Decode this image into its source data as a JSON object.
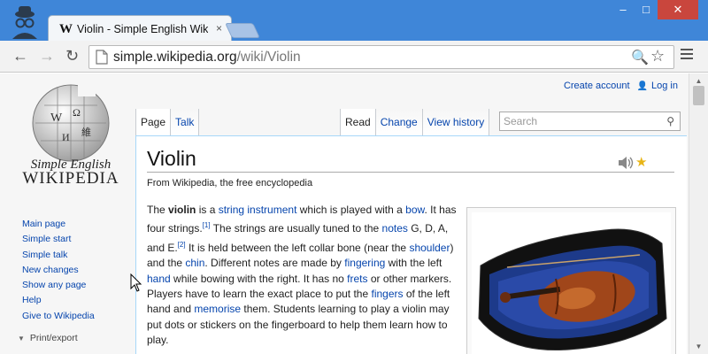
{
  "browser": {
    "tab_favicon": "W",
    "tab_title": "Violin - Simple English Wiki",
    "tab_close": "×",
    "url_host": "simple.wikipedia.org",
    "url_path": "/wiki/Violin",
    "window_controls": {
      "minimize": "–",
      "maximize": "□",
      "close": "✕"
    },
    "nav": {
      "back": "←",
      "forward": "→",
      "reload": "↻"
    },
    "omnibox_icons": {
      "zoom": "🔍",
      "bookmark": "☆"
    }
  },
  "header": {
    "create_account": "Create account",
    "login": "Log in"
  },
  "logo": {
    "line1": "Simple English",
    "line2": "WIKIPEDIA"
  },
  "page_tabs": {
    "left": [
      "Page",
      "Talk"
    ],
    "right": [
      "Read",
      "Change",
      "View history"
    ]
  },
  "search": {
    "placeholder": "Search"
  },
  "sidebar": {
    "items": [
      "Main page",
      "Simple start",
      "Simple talk",
      "New changes",
      "Show any page",
      "Help",
      "Give to Wikipedia"
    ],
    "print_export": "Print/export"
  },
  "article": {
    "title": "Violin",
    "from": "From Wikipedia, the free encyclopedia",
    "paragraph": [
      {
        "t": "The "
      },
      {
        "b": "violin"
      },
      {
        "t": " is a "
      },
      {
        "a": "string instrument"
      },
      {
        "t": " which is played with a "
      },
      {
        "a": "bow"
      },
      {
        "t": ". It has four strings."
      },
      {
        "s": "[1]"
      },
      {
        "t": " The strings are usually tuned to the "
      },
      {
        "a": "notes"
      },
      {
        "t": " G, D, A, and E."
      },
      {
        "s": "[2]"
      },
      {
        "t": " It is held between the left collar bone (near the "
      },
      {
        "a": "shoulder"
      },
      {
        "t": ") and the "
      },
      {
        "a": "chin"
      },
      {
        "t": ". Different notes are made by "
      },
      {
        "a": "fingering"
      },
      {
        "t": " with the left "
      },
      {
        "a": "hand"
      },
      {
        "t": " while bowing with the right. It has no "
      },
      {
        "a": "frets"
      },
      {
        "t": " or other markers. Players have to learn the exact place to put the "
      },
      {
        "a": "fingers"
      },
      {
        "t": " of the left hand and "
      },
      {
        "a": "memorise"
      },
      {
        "t": " them. Students learning to play a violin may put dots or stickers on the fingerboard to help them learn how to play."
      }
    ]
  },
  "colors": {
    "titlebar": "#3f86d8",
    "link": "#0645ad",
    "close_button": "#c9463d",
    "star": "#e8b517",
    "case_interior": "#1d3a8a",
    "violin_body": "#a0461a"
  }
}
